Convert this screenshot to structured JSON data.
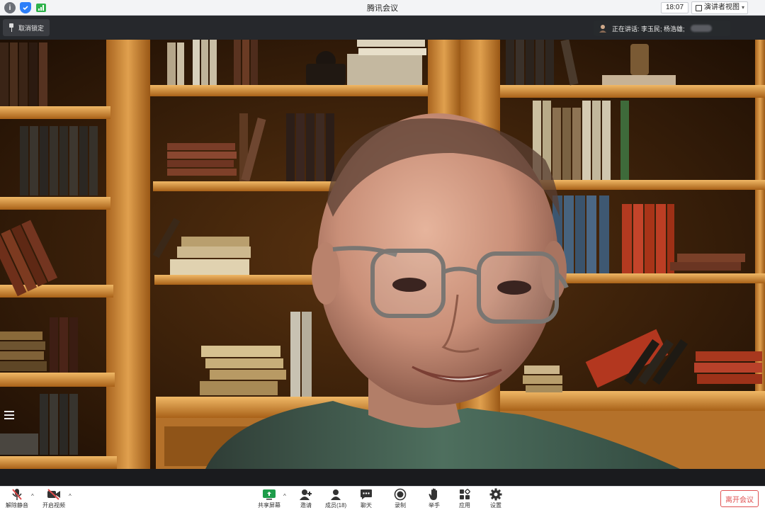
{
  "titlebar": {
    "title": "腾讯会议",
    "clock": "18:07",
    "view_label": "演讲者视图",
    "icons": [
      "info-icon",
      "shield-icon",
      "signal-icon"
    ]
  },
  "video": {
    "unpin_label": "取消锁定",
    "speaking_label": "正在讲话: 李玉民; 杨浩雄;"
  },
  "toolbar": {
    "unmute_label": "解除静音",
    "start_video_label": "开启视频",
    "share_label": "共享屏幕",
    "invite_label": "邀请",
    "members_label": "成员(18)",
    "chat_label": "聊天",
    "record_label": "录制",
    "raise_hand_label": "举手",
    "apps_label": "应用",
    "settings_label": "设置",
    "leave_label": "离开会议"
  },
  "colors": {
    "leave": "#e05151",
    "share_icon": "#1e9c4a",
    "muted_icon": "#e04b4b"
  }
}
